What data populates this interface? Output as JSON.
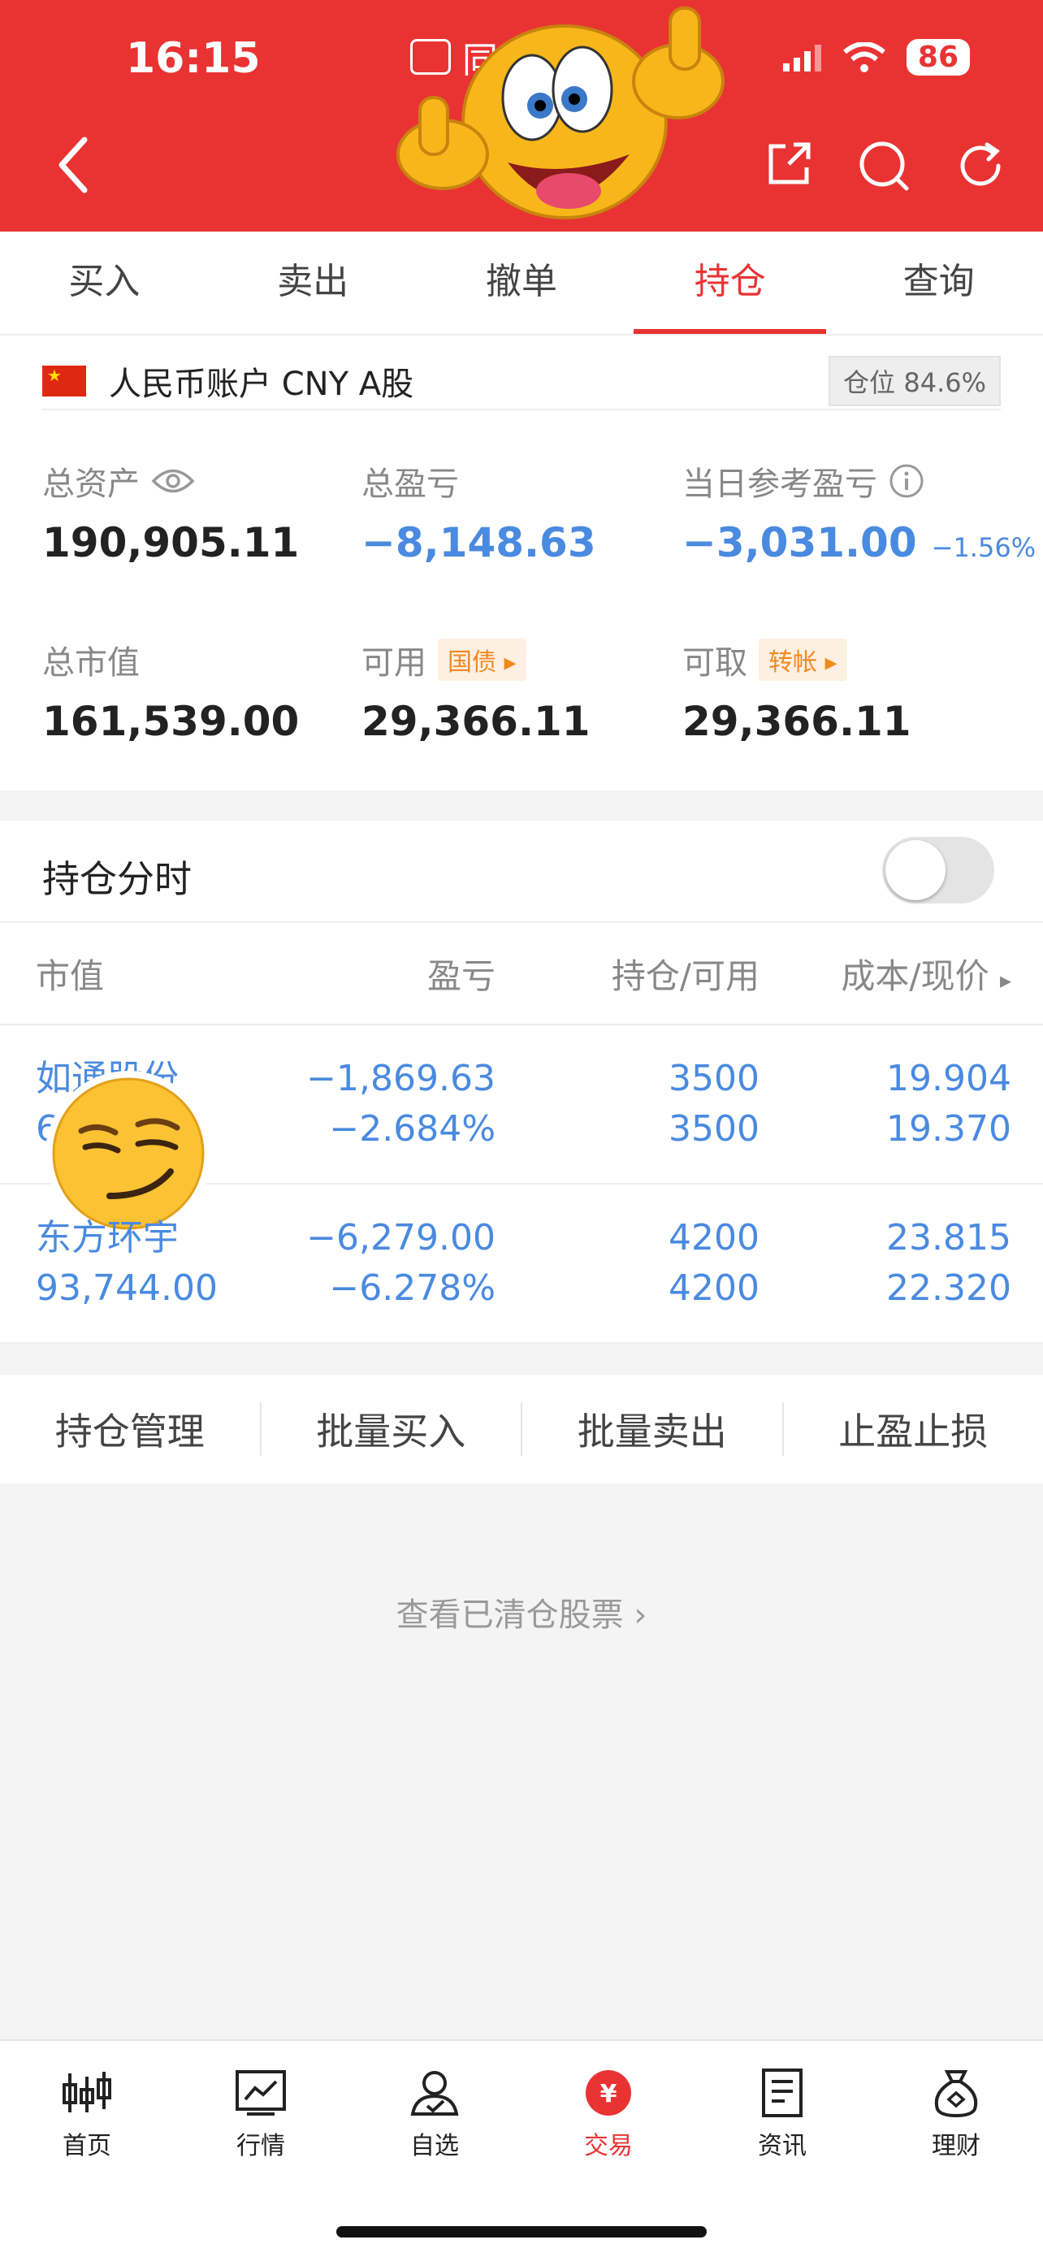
{
  "status": {
    "time": "16:15",
    "battery": "86"
  },
  "header": {
    "app_name": "同花顺"
  },
  "tabs": [
    {
      "label": "买入"
    },
    {
      "label": "卖出"
    },
    {
      "label": "撤单"
    },
    {
      "label": "持仓",
      "active": true
    },
    {
      "label": "查询"
    }
  ],
  "account": {
    "label": "人民币账户 CNY A股",
    "position_label": "仓位",
    "position_value": "84.6%",
    "total_assets": {
      "label": "总资产",
      "value": "190,905.11"
    },
    "total_pnl": {
      "label": "总盈亏",
      "value": "−8,148.63"
    },
    "daily_pnl": {
      "label": "当日参考盈亏",
      "value": "−3,031.00",
      "percent": "−1.56%"
    },
    "market_value": {
      "label": "总市值",
      "value": "161,539.00"
    },
    "available": {
      "label": "可用",
      "tag": "国债",
      "value": "29,366.11"
    },
    "withdrawable": {
      "label": "可取",
      "tag": "转帐",
      "value": "29,366.11"
    }
  },
  "holding_timeshare": {
    "label": "持仓分时",
    "enabled": false
  },
  "table": {
    "headers": [
      "市值",
      "盈亏",
      "持仓/可用",
      "成本/现价"
    ],
    "rows": [
      {
        "name": "如通股份",
        "market_value": "6",
        "pnl": "−1,869.63",
        "pnl_pct": "−2.684%",
        "hold": "3500",
        "avail": "3500",
        "cost": "19.904",
        "price": "19.370"
      },
      {
        "name": "东方环宇",
        "market_value": "93,744.00",
        "pnl": "−6,279.00",
        "pnl_pct": "−6.278%",
        "hold": "4200",
        "avail": "4200",
        "cost": "23.815",
        "price": "22.320"
      }
    ]
  },
  "actions": [
    "持仓管理",
    "批量买入",
    "批量卖出",
    "止盈止损"
  ],
  "cleared_link": "查看已清仓股票",
  "tabbar": [
    {
      "label": "首页",
      "icon": "candlestick-icon"
    },
    {
      "label": "行情",
      "icon": "chart-icon"
    },
    {
      "label": "自选",
      "icon": "user-check-icon"
    },
    {
      "label": "交易",
      "icon": "yuan-icon",
      "active": true
    },
    {
      "label": "资讯",
      "icon": "document-icon"
    },
    {
      "label": "理财",
      "icon": "money-bag-icon"
    }
  ],
  "colors": {
    "brand_red": "#e93333",
    "loss_blue": "#4a8ae0",
    "tag_orange": "#f28a1f"
  }
}
